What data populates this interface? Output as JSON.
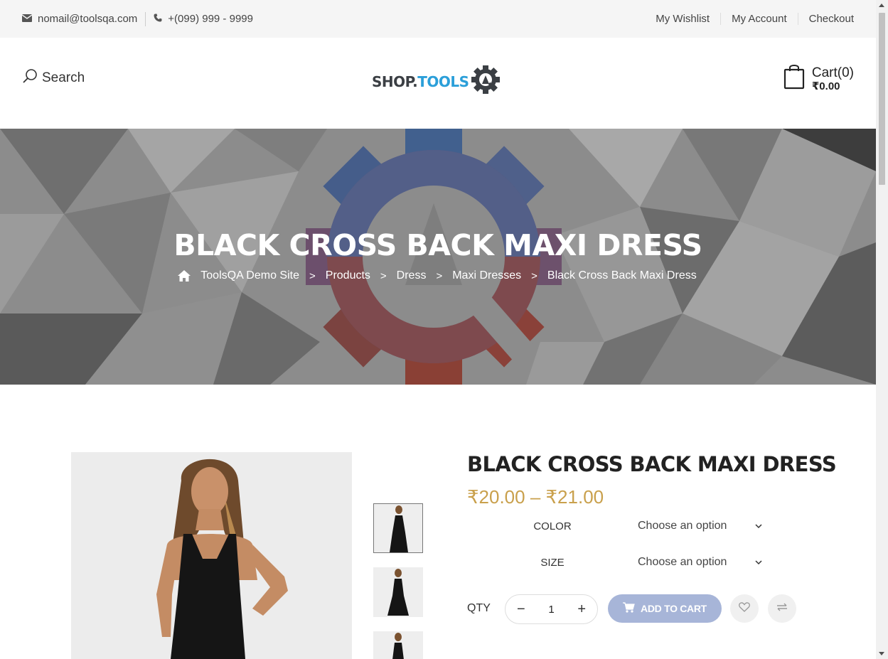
{
  "topbar": {
    "email": "nomail@toolsqa.com",
    "phone": "+(099) 999 - 9999",
    "links": [
      "My Wishlist",
      "My Account",
      "Checkout"
    ]
  },
  "header": {
    "search_label": "Search",
    "logo_part1": "SHOP.",
    "logo_part2": "TOOLS",
    "cart_count": "Cart(0)",
    "cart_total": "₹0.00"
  },
  "hero": {
    "title": "BLACK CROSS BACK MAXI DRESS",
    "breadcrumb": [
      "ToolsQA Demo Site",
      "Products",
      "Dress",
      "Maxi Dresses",
      "Black Cross Back Maxi Dress"
    ],
    "separator": ">"
  },
  "product": {
    "title": "BLACK CROSS BACK MAXI DRESS",
    "price": "₹20.00 – ₹21.00",
    "options": [
      {
        "label": "COLOR",
        "value": "Choose an option"
      },
      {
        "label": "SIZE",
        "value": "Choose an option"
      }
    ],
    "qty_label": "QTY",
    "qty_value": "1",
    "qty_minus": "−",
    "qty_plus": "+",
    "add_to_cart": "ADD TO CART"
  },
  "colors": {
    "accent_price": "#c9a04c",
    "add_to_cart_bg": "#a7b5d8",
    "logo_tools": "#2b9fd9"
  }
}
